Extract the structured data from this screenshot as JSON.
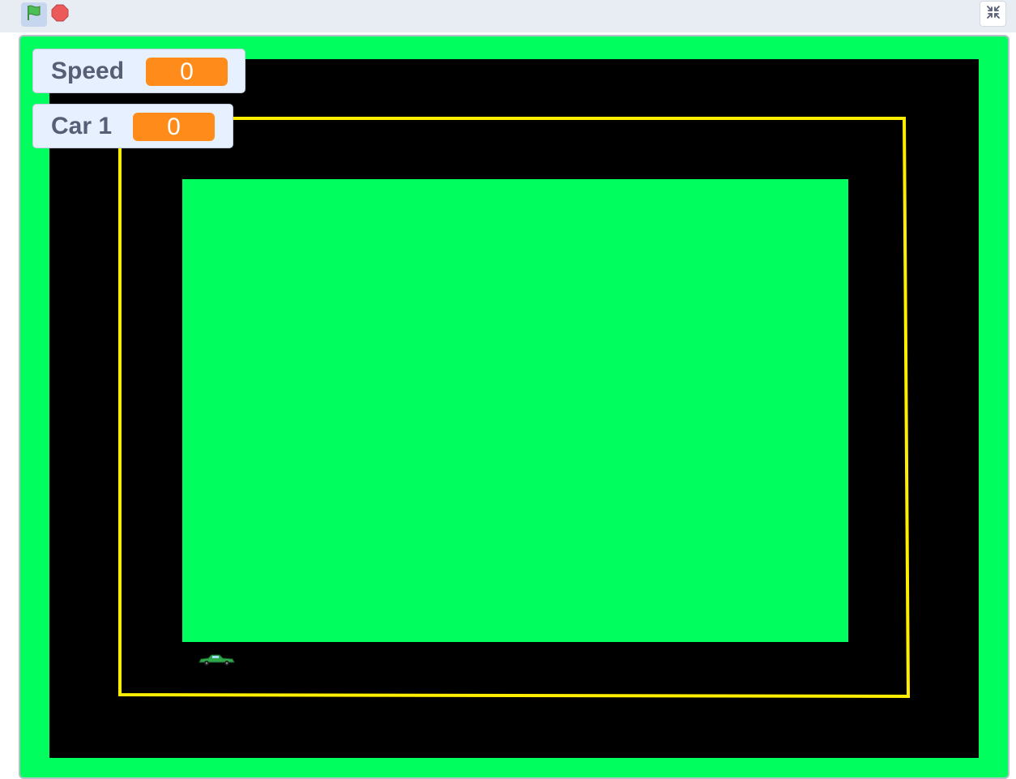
{
  "toolbar": {
    "green_flag_icon": "green-flag-icon",
    "stop_icon": "stop-sign-icon",
    "fullscreen_icon": "exit-fullscreen-icon"
  },
  "monitors": [
    {
      "label": "Speed",
      "value": "0"
    },
    {
      "label": "Car 1",
      "value": "0"
    }
  ],
  "colors": {
    "grass": "#00ff5e",
    "track": "#000000",
    "lane_line": "#ffee00",
    "monitor_value": "#ff8c1a",
    "flag": "#4cbf56",
    "stop": "#ec5959"
  }
}
